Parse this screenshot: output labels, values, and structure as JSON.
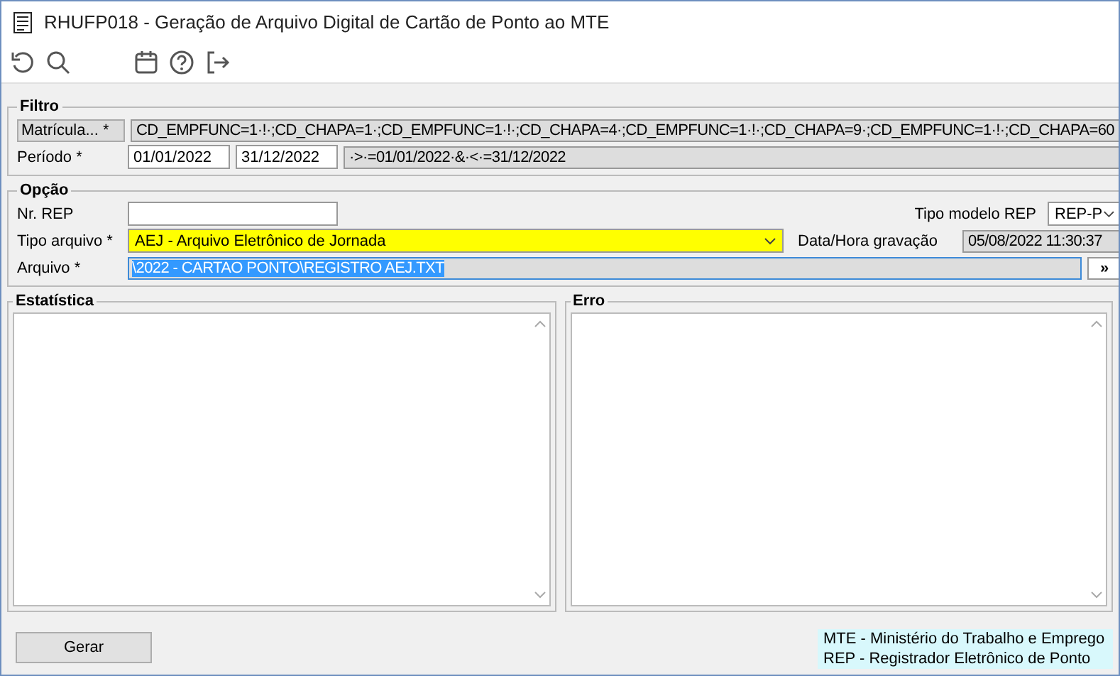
{
  "window": {
    "title": "RHUFP018 - Geração de Arquivo Digital de Cartão de Ponto ao MTE"
  },
  "filtro": {
    "title": "Filtro",
    "matricula": {
      "label": "Matrícula... *",
      "value": "CD_EMPFUNC=1·!·;CD_CHAPA=1·;CD_EMPFUNC=1·!·;CD_CHAPA=4·;CD_EMPFUNC=1·!·;CD_CHAPA=9·;CD_EMPFUNC=1·!·;CD_CHAPA=60"
    },
    "periodo": {
      "label": "Período *",
      "start": "01/01/2022",
      "end": "31/12/2022",
      "expression": "·>·=01/01/2022·&·<·=31/12/2022"
    }
  },
  "opcao": {
    "title": "Opção",
    "nr_rep": {
      "label": "Nr. REP"
    },
    "tipo_modelo_rep": {
      "label": "Tipo modelo REP",
      "value": "REP-P"
    },
    "tipo_arquivo": {
      "label": "Tipo arquivo *",
      "value": "AEJ - Arquivo Eletrônico de Jornada"
    },
    "data_hora": {
      "label": "Data/Hora gravação",
      "value": "05/08/2022 11:30:37"
    },
    "arquivo": {
      "label": "Arquivo *",
      "value": "\\2022 - CARTAO PONTO\\REGISTRO AEJ.TXT",
      "button": "»"
    }
  },
  "panels": [
    {
      "title": "Estatística"
    },
    {
      "title": "Erro"
    }
  ],
  "buttons": [
    {
      "label": "Gerar"
    }
  ],
  "legend": [
    "MTE - Ministério do Trabalho e Emprego",
    "REP - Registrador Eletrônico de Ponto"
  ]
}
